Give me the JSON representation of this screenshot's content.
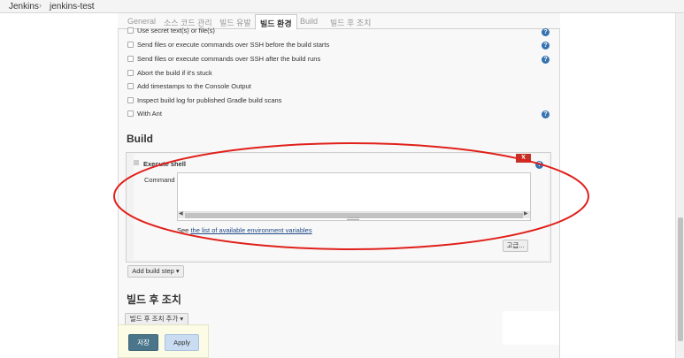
{
  "breadcrumb": {
    "items": [
      "Jenkins",
      "jenkins-test"
    ],
    "separator": "›"
  },
  "tabs": [
    "General",
    "소스 코드 관리",
    "빌드 유발",
    "빌드 환경",
    "Build",
    "빌드 후 조치"
  ],
  "active_tab": "빌드 환경",
  "build_env_options": [
    "Use secret text(s) or file(s)",
    "Send files or execute commands over SSH before the build starts",
    "Send files or execute commands over SSH after the build runs",
    "Abort the build if it's stuck",
    "Add timestamps to the Console Output",
    "Inspect build log for published Gradle build scans",
    "With Ant"
  ],
  "build": {
    "heading": "Build",
    "step_title": "Execute shell",
    "delete_label": "X",
    "command_label": "Command",
    "command_value": "",
    "env_prefix": "See ",
    "env_link": "the list of available environment variables",
    "advanced_button": "고급...",
    "add_step_button": "Add build step ▾"
  },
  "post_build": {
    "heading": "빌드 후 조치",
    "add_action_button": "빌드 후 조치 추가 ▾"
  },
  "footer": {
    "save_button": "저장",
    "apply_button": "Apply"
  },
  "colors": {
    "annotation": "#e0201a",
    "save": "#4b758b",
    "apply": "#c9dcf1",
    "delete": "#c43126",
    "help": "#3572b0"
  }
}
